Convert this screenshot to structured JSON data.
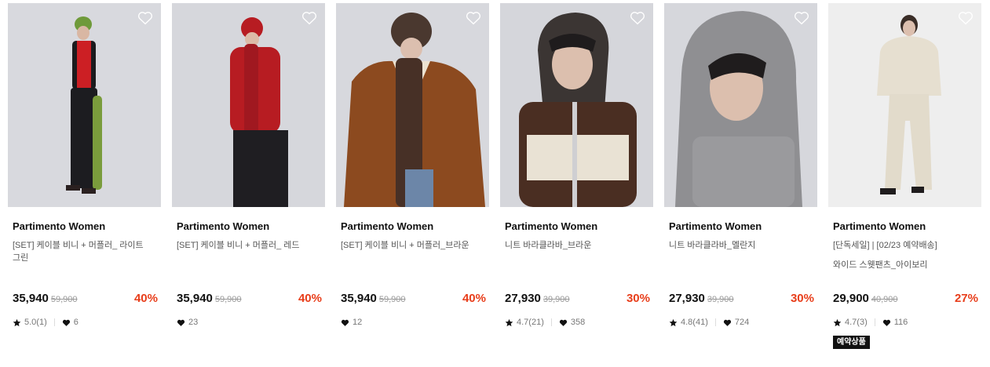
{
  "icons": {
    "wishlist": "heart-outline-icon",
    "rating": "star-icon",
    "likes": "heart-filled-icon"
  },
  "colors": {
    "discount": "#e83e1b",
    "tag_bg": "#111111"
  },
  "products": [
    {
      "brand": "Partimento Women",
      "name_lines": [
        "[SET] 케이블 비니 + 머플러_ 라이트",
        "그린"
      ],
      "price": "35,940",
      "original_price": "59,900",
      "discount": "40%",
      "rating": "5.0(1)",
      "likes": "6",
      "tag": ""
    },
    {
      "brand": "Partimento Women",
      "name_lines": [
        "[SET] 케이블 비니 + 머플러_ 레드"
      ],
      "price": "35,940",
      "original_price": "59,900",
      "discount": "40%",
      "rating": "",
      "likes": "23",
      "tag": ""
    },
    {
      "brand": "Partimento Women",
      "name_lines": [
        "[SET] 케이블 비니 + 머플러_브라운"
      ],
      "price": "35,940",
      "original_price": "59,900",
      "discount": "40%",
      "rating": "",
      "likes": "12",
      "tag": ""
    },
    {
      "brand": "Partimento Women",
      "name_lines": [
        "니트 바라클라바_브라운"
      ],
      "price": "27,930",
      "original_price": "39,900",
      "discount": "30%",
      "rating": "4.7(21)",
      "likes": "358",
      "tag": ""
    },
    {
      "brand": "Partimento Women",
      "name_lines": [
        "니트 바라클라바_멜란지"
      ],
      "price": "27,930",
      "original_price": "39,900",
      "discount": "30%",
      "rating": "4.8(41)",
      "likes": "724",
      "tag": ""
    },
    {
      "brand": "Partimento Women",
      "name_lines": [
        "[단독세일] | [02/23 예약배송]",
        "와이드 스웻팬츠_아이보리"
      ],
      "price": "29,900",
      "original_price": "40,900",
      "discount": "27%",
      "rating": "4.7(3)",
      "likes": "116",
      "tag": "예약상품"
    }
  ]
}
